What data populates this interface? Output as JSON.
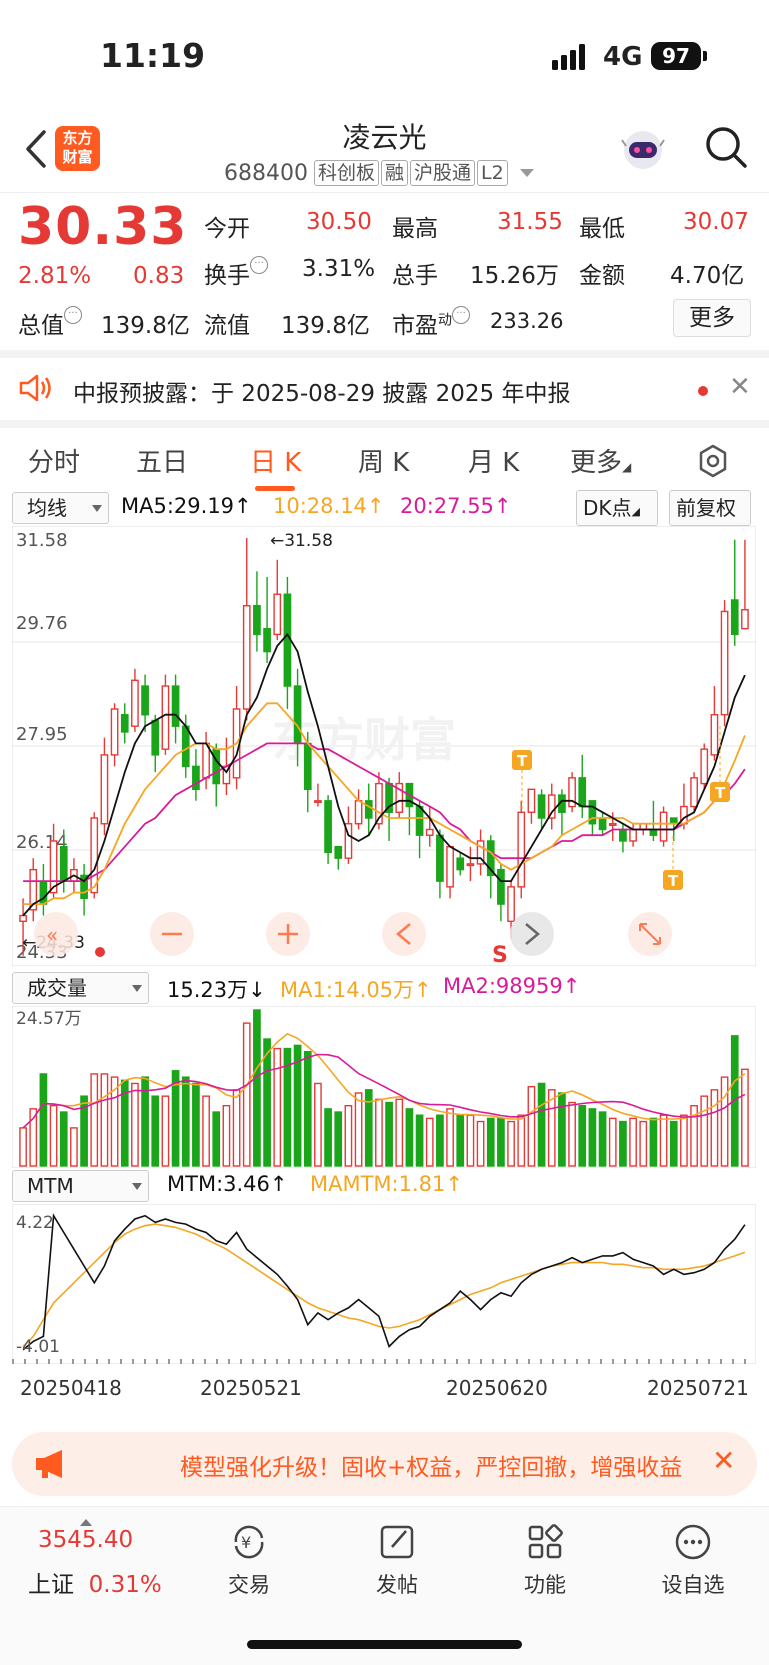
{
  "status": {
    "time": "11:19",
    "network": "4G",
    "battery": "97"
  },
  "header": {
    "app_logo": "东方\n财富",
    "title": "凌云光",
    "code": "688400",
    "tags": [
      "科创板",
      "融",
      "沪股通",
      "L2"
    ]
  },
  "quote": {
    "price": "30.33",
    "change_pct": "2.81%",
    "change": "0.83",
    "open_label": "今开",
    "open": "30.50",
    "high_label": "最高",
    "high": "31.55",
    "low_label": "最低",
    "low": "30.07",
    "turnover_label": "换手",
    "turnover": "3.31%",
    "volume_label": "总手",
    "volume": "15.26万",
    "amount_label": "金额",
    "amount": "4.70亿",
    "mktcap_label": "总值",
    "mktcap": "139.8亿",
    "float_label": "流值",
    "float": "139.8亿",
    "pe_label": "市盈",
    "pe_sup": "动",
    "pe": "233.26",
    "more": "更多"
  },
  "notice": {
    "text": "中报预披露：于 2025-08-29 披露 2025 年中报"
  },
  "tabs": [
    "分时",
    "五日",
    "日 K",
    "周 K",
    "月 K",
    "更多"
  ],
  "kline_bar": {
    "select": "均线",
    "ma5": "MA5:29.19↑",
    "ma10": "10:28.14↑",
    "ma20": "20:27.55↑",
    "dk": "DK点",
    "adjust": "前复权"
  },
  "kline_axis": {
    "y1": "31.58",
    "y2": "29.76",
    "y3": "27.95",
    "y4": "26.14",
    "y5": "24.33",
    "max_label": "←31.58",
    "min_label": "←24.33"
  },
  "signal_s": "S",
  "t_markers": [
    "T",
    "T",
    "T"
  ],
  "volume_bar": {
    "select": "成交量",
    "vol": "15.23万↓",
    "ma1": "MA1:14.05万↑",
    "ma2": "MA2:98959↑",
    "axis_max": "24.57万"
  },
  "mtm_bar": {
    "select": "MTM",
    "mtm": "MTM:3.46↑",
    "mamtm": "MAMTM:1.81↑",
    "axis_max": "4.22",
    "axis_min": "-4.01"
  },
  "dates": [
    "20250418",
    "20250521",
    "20250620",
    "20250721"
  ],
  "promo": {
    "text": "模型强化升级！固收+权益，严控回撤，增强收益"
  },
  "bottom": {
    "index_value": "3545.40",
    "index_name": "上证",
    "index_pct": "0.31%",
    "items": [
      "交易",
      "发帖",
      "功能",
      "设自选"
    ]
  },
  "colors": {
    "up": "#e53935",
    "down": "#1aa51a",
    "accent": "#ff5a1f",
    "ma10": "#f5a623",
    "ma20": "#d81b9a"
  },
  "chart_data": {
    "type": "candlestick",
    "title": "",
    "y_range": [
      24.33,
      31.58
    ],
    "candles": [
      [
        24.9,
        25.0,
        24.3,
        25.3
      ],
      [
        25.1,
        25.8,
        24.9,
        26.0
      ],
      [
        25.6,
        25.2,
        25.0,
        25.9
      ],
      [
        25.4,
        26.3,
        25.3,
        26.6
      ],
      [
        26.2,
        25.6,
        25.4,
        26.5
      ],
      [
        25.6,
        25.8,
        25.4,
        26.0
      ],
      [
        25.7,
        25.3,
        25.0,
        25.9
      ],
      [
        25.4,
        26.7,
        25.3,
        26.8
      ],
      [
        26.6,
        27.8,
        26.4,
        28.1
      ],
      [
        27.8,
        28.6,
        27.6,
        28.7
      ],
      [
        28.5,
        28.2,
        28.0,
        28.7
      ],
      [
        28.3,
        29.1,
        28.2,
        29.3
      ],
      [
        29.0,
        28.5,
        28.2,
        29.2
      ],
      [
        28.4,
        27.8,
        27.5,
        28.5
      ],
      [
        27.9,
        29.0,
        27.8,
        29.2
      ],
      [
        29.0,
        28.3,
        28.0,
        29.2
      ],
      [
        28.3,
        27.6,
        27.4,
        28.5
      ],
      [
        27.6,
        27.2,
        27.0,
        27.9
      ],
      [
        27.4,
        28.0,
        27.2,
        28.2
      ],
      [
        27.9,
        27.3,
        26.9,
        28.0
      ],
      [
        27.3,
        27.6,
        27.1,
        28.1
      ],
      [
        27.4,
        28.6,
        27.2,
        29.0
      ],
      [
        28.6,
        30.4,
        28.4,
        31.58
      ],
      [
        30.4,
        29.9,
        29.6,
        31.0
      ],
      [
        30.0,
        29.6,
        29.4,
        30.9
      ],
      [
        29.9,
        30.6,
        29.8,
        31.2
      ],
      [
        30.6,
        29.0,
        28.6,
        30.9
      ],
      [
        29.0,
        28.0,
        27.6,
        29.3
      ],
      [
        28.0,
        27.2,
        26.8,
        28.2
      ],
      [
        27.0,
        27.0,
        26.9,
        27.3
      ],
      [
        27.0,
        26.1,
        25.9,
        27.1
      ],
      [
        26.2,
        26.0,
        25.8,
        26.2
      ],
      [
        26.0,
        26.6,
        25.9,
        26.9
      ],
      [
        26.6,
        27.0,
        26.5,
        27.2
      ],
      [
        27.0,
        26.7,
        26.4,
        27.3
      ],
      [
        26.6,
        27.3,
        26.5,
        27.5
      ],
      [
        27.3,
        26.8,
        26.3,
        27.4
      ],
      [
        26.8,
        27.3,
        26.7,
        27.5
      ],
      [
        27.3,
        26.9,
        26.4,
        27.3
      ],
      [
        26.9,
        26.4,
        26.0,
        27.0
      ],
      [
        26.4,
        26.5,
        26.2,
        26.9
      ],
      [
        26.4,
        25.6,
        25.3,
        26.5
      ],
      [
        25.5,
        26.2,
        25.3,
        26.2
      ],
      [
        26.0,
        25.8,
        25.7,
        26.1
      ],
      [
        25.9,
        25.9,
        25.6,
        26.2
      ],
      [
        25.9,
        26.3,
        25.7,
        26.5
      ],
      [
        26.3,
        25.7,
        25.3,
        26.4
      ],
      [
        25.8,
        25.2,
        24.9,
        25.9
      ],
      [
        24.9,
        25.5,
        24.6,
        25.6
      ],
      [
        25.5,
        26.8,
        25.3,
        27.0
      ],
      [
        26.8,
        27.2,
        26.6,
        27.2
      ],
      [
        27.1,
        26.7,
        26.5,
        27.2
      ],
      [
        26.7,
        27.1,
        26.5,
        27.3
      ],
      [
        27.1,
        26.8,
        26.4,
        27.2
      ],
      [
        26.9,
        27.4,
        26.8,
        27.5
      ],
      [
        27.4,
        26.9,
        26.7,
        27.8
      ],
      [
        27.0,
        26.6,
        26.4,
        27.0
      ],
      [
        26.7,
        26.5,
        26.4,
        26.8
      ],
      [
        26.6,
        26.6,
        26.3,
        26.8
      ],
      [
        26.5,
        26.3,
        26.1,
        26.6
      ],
      [
        26.3,
        26.5,
        26.2,
        26.6
      ],
      [
        26.5,
        26.6,
        26.4,
        26.6
      ],
      [
        26.5,
        26.4,
        26.3,
        27.0
      ],
      [
        26.3,
        26.8,
        26.2,
        26.9
      ],
      [
        26.7,
        26.6,
        26.3,
        26.7
      ],
      [
        26.6,
        26.9,
        26.5,
        27.3
      ],
      [
        26.9,
        27.4,
        26.8,
        27.5
      ],
      [
        27.3,
        27.9,
        27.2,
        28.0
      ],
      [
        27.8,
        28.5,
        27.7,
        29.0
      ],
      [
        28.5,
        30.3,
        28.3,
        30.5
      ],
      [
        30.5,
        29.9,
        29.7,
        31.55
      ],
      [
        30.0,
        30.33,
        30.07,
        31.55
      ]
    ],
    "ma5": [
      25.0,
      25.2,
      25.3,
      25.5,
      25.6,
      25.7,
      25.6,
      25.8,
      26.3,
      26.9,
      27.5,
      28.0,
      28.3,
      28.4,
      28.5,
      28.5,
      28.3,
      28.0,
      28.0,
      27.7,
      27.5,
      27.8,
      28.5,
      28.8,
      29.3,
      29.7,
      29.9,
      29.6,
      28.9,
      28.3,
      27.6,
      26.9,
      26.4,
      26.3,
      26.4,
      26.7,
      26.9,
      27.0,
      27.0,
      26.9,
      26.7,
      26.4,
      26.2,
      26.1,
      26.0,
      26.0,
      25.8,
      25.6,
      25.6,
      25.9,
      26.2,
      26.5,
      26.8,
      27.0,
      27.0,
      26.9,
      26.9,
      26.8,
      26.7,
      26.6,
      26.5,
      26.5,
      26.5,
      26.5,
      26.5,
      26.7,
      26.8,
      27.2,
      27.6,
      28.2,
      28.8,
      29.19
    ],
    "ma10": [
      25.2,
      25.2,
      25.2,
      25.3,
      25.3,
      25.4,
      25.4,
      25.5,
      25.8,
      26.2,
      26.6,
      26.9,
      27.2,
      27.4,
      27.6,
      27.8,
      27.9,
      28.0,
      28.0,
      27.9,
      27.9,
      28.0,
      28.3,
      28.5,
      28.7,
      28.7,
      28.5,
      28.3,
      28.0,
      27.8,
      27.6,
      27.4,
      27.2,
      27.0,
      26.9,
      26.8,
      26.7,
      26.7,
      26.7,
      26.7,
      26.7,
      26.6,
      26.5,
      26.4,
      26.3,
      26.2,
      26.1,
      25.9,
      25.8,
      25.9,
      26.0,
      26.1,
      26.2,
      26.4,
      26.5,
      26.6,
      26.7,
      26.7,
      26.7,
      26.7,
      26.6,
      26.6,
      26.6,
      26.6,
      26.6,
      26.6,
      26.7,
      26.8,
      27.0,
      27.3,
      27.7,
      28.14
    ],
    "ma20": [
      25.6,
      25.6,
      25.6,
      25.6,
      25.6,
      25.6,
      25.6,
      25.7,
      25.8,
      26.0,
      26.2,
      26.4,
      26.6,
      26.7,
      26.9,
      27.1,
      27.2,
      27.3,
      27.4,
      27.5,
      27.6,
      27.7,
      27.8,
      27.9,
      28.0,
      28.0,
      28.0,
      28.0,
      28.0,
      27.9,
      27.9,
      27.8,
      27.7,
      27.6,
      27.5,
      27.4,
      27.3,
      27.2,
      27.1,
      27.0,
      26.9,
      26.8,
      26.6,
      26.5,
      26.3,
      26.2,
      26.1,
      26.0,
      26.0,
      26.0,
      26.0,
      26.1,
      26.2,
      26.3,
      26.3,
      26.4,
      26.4,
      26.4,
      26.5,
      26.5,
      26.5,
      26.5,
      26.5,
      26.5,
      26.5,
      26.6,
      26.7,
      26.8,
      27.0,
      27.1,
      27.3,
      27.55
    ],
    "volume_range": [
      0,
      245700
    ],
    "volume": [
      60000,
      90000,
      145000,
      95000,
      85000,
      60000,
      110000,
      145000,
      145000,
      140000,
      135000,
      130000,
      140000,
      110000,
      110000,
      150000,
      140000,
      130000,
      110000,
      85000,
      95000,
      120000,
      225000,
      245700,
      200000,
      185000,
      185000,
      190000,
      180000,
      130000,
      90000,
      85000,
      95000,
      115000,
      120000,
      105000,
      100000,
      105000,
      90000,
      80000,
      75000,
      80000,
      90000,
      80000,
      80000,
      70000,
      75000,
      75000,
      70000,
      80000,
      125000,
      130000,
      120000,
      115000,
      100000,
      95000,
      90000,
      85000,
      75000,
      70000,
      75000,
      70000,
      75000,
      80000,
      70000,
      80000,
      95000,
      110000,
      120000,
      140000,
      205000,
      152300
    ],
    "vol_ma1": [],
    "mtm_range": [
      -4.01,
      4.22
    ],
    "mtm": [
      -4.0,
      -3.5,
      -3.2,
      4.0,
      3.0,
      2.0,
      1.0,
      0.0,
      1.0,
      2.5,
      3.2,
      3.8,
      4.0,
      3.6,
      3.8,
      3.6,
      3.5,
      3.2,
      3.0,
      2.5,
      2.3,
      3.0,
      2.0,
      1.5,
      1.0,
      0.5,
      -0.2,
      -1.0,
      -2.5,
      -1.8,
      -2.2,
      -1.8,
      -1.5,
      -1.0,
      -1.5,
      -2.0,
      -3.8,
      -3.2,
      -2.8,
      -2.6,
      -2.0,
      -1.6,
      -1.2,
      -0.5,
      -1.0,
      -1.6,
      -1.0,
      -0.6,
      -0.8,
      0.0,
      0.5,
      0.8,
      1.0,
      1.2,
      1.5,
      1.2,
      1.4,
      1.6,
      1.6,
      1.8,
      1.4,
      1.2,
      1.0,
      0.5,
      0.8,
      0.5,
      0.6,
      0.8,
      1.2,
      2.0,
      2.6,
      3.46
    ],
    "mamtm": [
      -3.8,
      -3.2,
      -2.2,
      -1.2,
      -0.6,
      0.0,
      0.6,
      1.2,
      1.8,
      2.4,
      2.9,
      3.2,
      3.4,
      3.5,
      3.4,
      3.3,
      3.1,
      2.9,
      2.6,
      2.3,
      2.0,
      1.6,
      1.2,
      0.8,
      0.4,
      0.0,
      -0.4,
      -0.8,
      -1.2,
      -1.5,
      -1.7,
      -1.9,
      -2.1,
      -2.2,
      -2.4,
      -2.6,
      -2.7,
      -2.6,
      -2.4,
      -2.2,
      -1.9,
      -1.6,
      -1.3,
      -1.0,
      -0.7,
      -0.5,
      -0.3,
      0.0,
      0.2,
      0.4,
      0.6,
      0.8,
      1.0,
      1.1,
      1.2,
      1.2,
      1.2,
      1.2,
      1.1,
      1.1,
      1.0,
      0.9,
      0.9,
      0.8,
      0.8,
      0.8,
      0.9,
      1.0,
      1.2,
      1.4,
      1.6,
      1.81
    ]
  }
}
